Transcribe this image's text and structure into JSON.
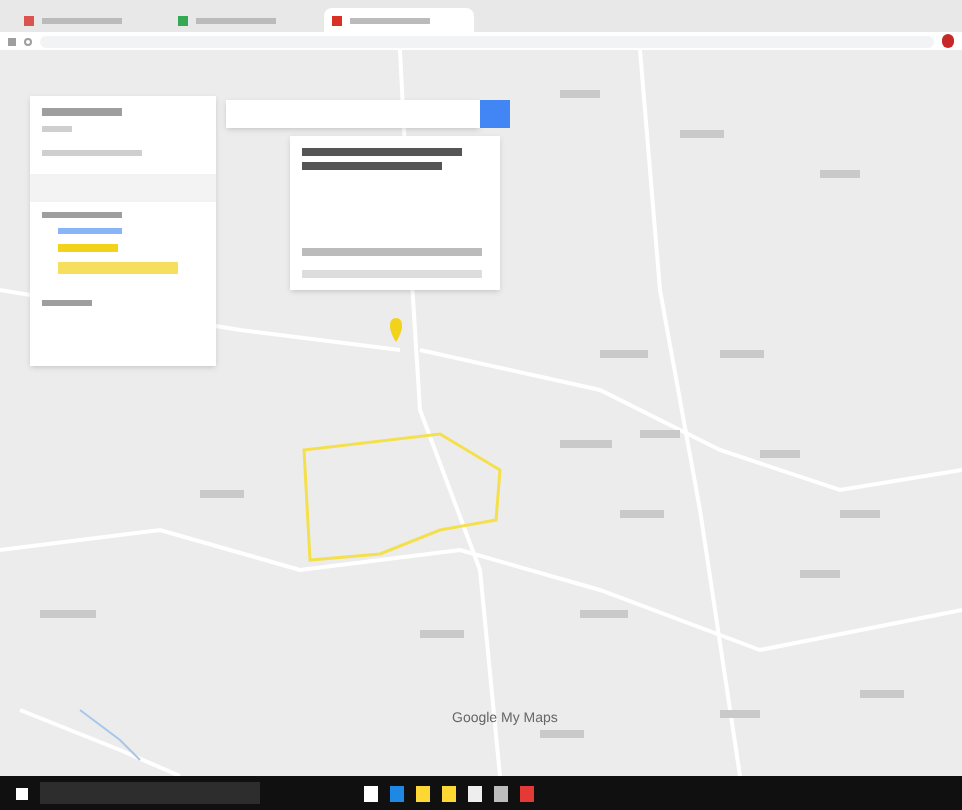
{
  "browser": {
    "tabs": [
      {
        "selected": false,
        "color": "#d9534f"
      },
      {
        "selected": false,
        "color": "#34a853"
      },
      {
        "selected": true,
        "color": "#d93025"
      }
    ]
  },
  "map": {
    "logo": "Google My Maps"
  },
  "taskbar": {
    "apps": [
      {
        "color": "#ffffff"
      },
      {
        "color": "#1e88e5"
      },
      {
        "color": "#fdd835"
      },
      {
        "color": "#fdd835"
      },
      {
        "color": "#eeeeee"
      },
      {
        "color": "#bdbdbd"
      },
      {
        "color": "#e53935"
      }
    ]
  }
}
